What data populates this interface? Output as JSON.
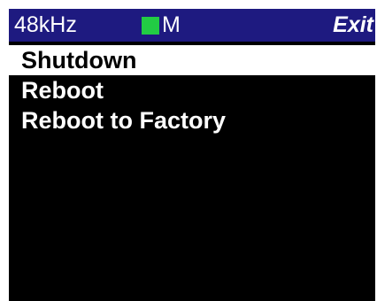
{
  "status_bar": {
    "sample_rate": "48kHz",
    "meter_label": "M",
    "meter_color": "#22cc44",
    "exit_label": "Exit",
    "background_color": "#1e1a80"
  },
  "menu": {
    "items": [
      {
        "label": "Shutdown",
        "selected": true
      },
      {
        "label": "Reboot",
        "selected": false
      },
      {
        "label": "Reboot to Factory",
        "selected": false
      }
    ]
  }
}
